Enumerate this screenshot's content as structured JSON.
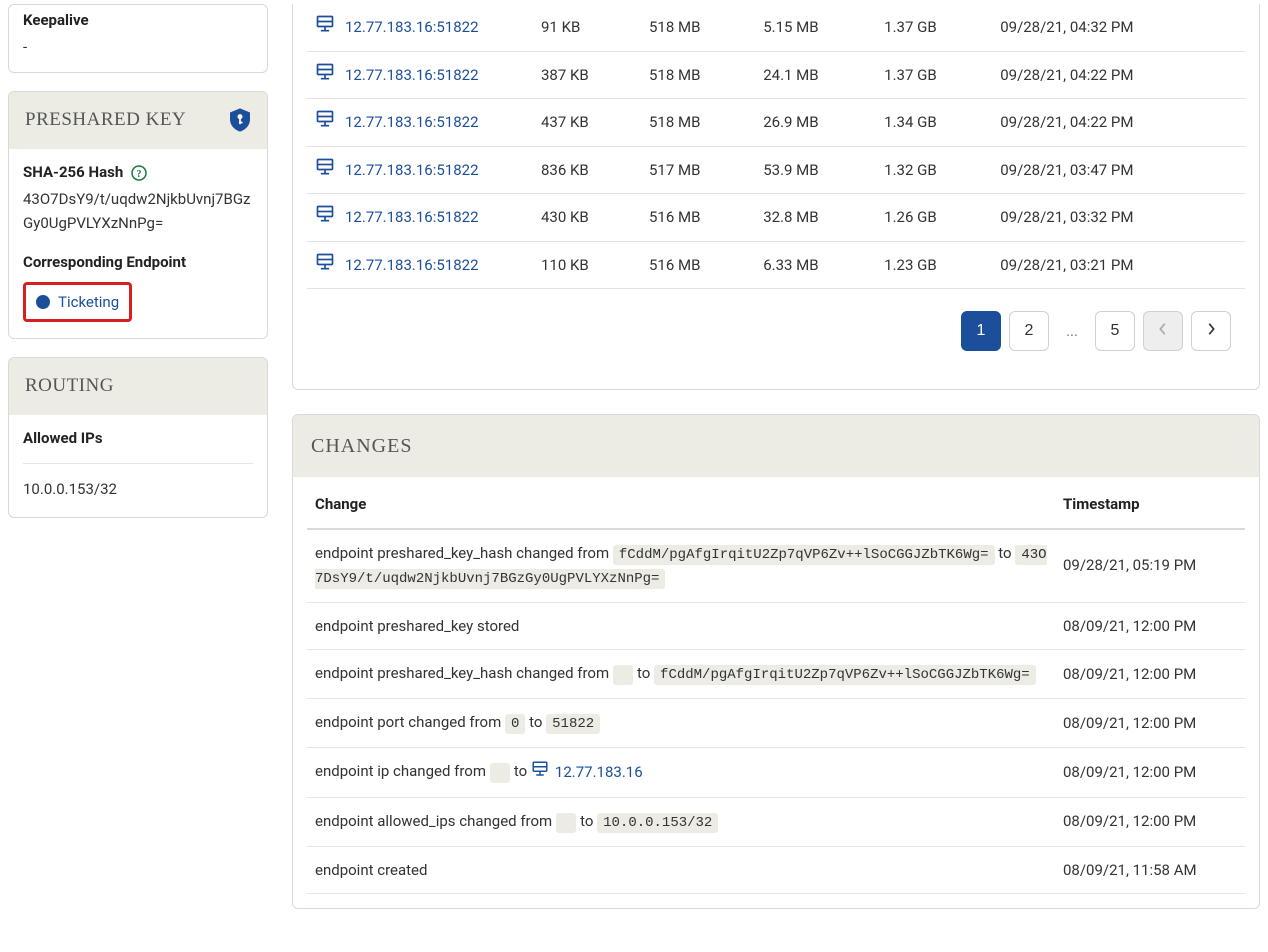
{
  "sidebar": {
    "keepalive_label": "Keepalive",
    "keepalive_value": "-",
    "preshared_title": "PRESHARED KEY",
    "sha_label": "SHA-256 Hash",
    "sha_value": "43O7DsY9/t/uqdw2NjkbUvnj7BGzGy0UgPVLYXzNnPg=",
    "corr_endpoint_label": "Corresponding Endpoint",
    "corr_endpoint_value": "Ticketing",
    "routing_title": "ROUTING",
    "allowed_ips_label": "Allowed IPs",
    "allowed_ips_value": "10.0.0.153/32"
  },
  "traffic": {
    "rows": [
      {
        "addr": "12.77.183.16:51822",
        "c1": "91 KB",
        "c2": "518 MB",
        "c3": "5.15 MB",
        "c4": "1.37 GB",
        "ts": "09/28/21, 04:32 PM"
      },
      {
        "addr": "12.77.183.16:51822",
        "c1": "387 KB",
        "c2": "518 MB",
        "c3": "24.1 MB",
        "c4": "1.37 GB",
        "ts": "09/28/21, 04:22 PM"
      },
      {
        "addr": "12.77.183.16:51822",
        "c1": "437 KB",
        "c2": "518 MB",
        "c3": "26.9 MB",
        "c4": "1.34 GB",
        "ts": "09/28/21, 04:22 PM"
      },
      {
        "addr": "12.77.183.16:51822",
        "c1": "836 KB",
        "c2": "517 MB",
        "c3": "53.9 MB",
        "c4": "1.32 GB",
        "ts": "09/28/21, 03:47 PM"
      },
      {
        "addr": "12.77.183.16:51822",
        "c1": "430 KB",
        "c2": "516 MB",
        "c3": "32.8 MB",
        "c4": "1.26 GB",
        "ts": "09/28/21, 03:32 PM"
      },
      {
        "addr": "12.77.183.16:51822",
        "c1": "110 KB",
        "c2": "516 MB",
        "c3": "6.33 MB",
        "c4": "1.23 GB",
        "ts": "09/28/21, 03:21 PM"
      }
    ]
  },
  "pagination": {
    "p1": "1",
    "p2": "2",
    "ell": "...",
    "p5": "5"
  },
  "changes": {
    "title": "CHANGES",
    "col_change": "Change",
    "col_timestamp": "Timestamp",
    "rows": [
      {
        "prefix": "endpoint preshared_key_hash changed from ",
        "code1": "fCddM/pgAfgIrqitU2Zp7qVP6Zv++lSoCGGJZbTK6Wg=",
        "mid": " to ",
        "code2": "43O7DsY9/t/uqdw2NjkbUvnj7BGzGy0UgPVLYXzNnPg=",
        "ts": "09/28/21, 05:19 PM",
        "type": "two_code"
      },
      {
        "text": "endpoint preshared_key stored",
        "ts": "08/09/21, 12:00 PM",
        "type": "plain"
      },
      {
        "prefix": "endpoint preshared_key_hash changed from ",
        "code1": "",
        "mid": " to ",
        "code2": "fCddM/pgAfgIrqitU2Zp7qVP6Zv++lSoCGGJZbTK6Wg=",
        "ts": "08/09/21, 12:00 PM",
        "type": "two_code_empty"
      },
      {
        "prefix": "endpoint port changed from ",
        "code1": "0",
        "mid": " to ",
        "code2": "51822",
        "ts": "08/09/21, 12:00 PM",
        "type": "two_code"
      },
      {
        "prefix": "endpoint ip changed from ",
        "mid": " to ",
        "ip": "12.77.183.16",
        "ts": "08/09/21, 12:00 PM",
        "type": "ip_change"
      },
      {
        "prefix": "endpoint allowed_ips changed from ",
        "mid": " to ",
        "code2": "10.0.0.153/32",
        "ts": "08/09/21, 12:00 PM",
        "type": "code_to"
      },
      {
        "text": "endpoint created",
        "ts": "08/09/21, 11:58 AM",
        "type": "plain"
      }
    ]
  }
}
